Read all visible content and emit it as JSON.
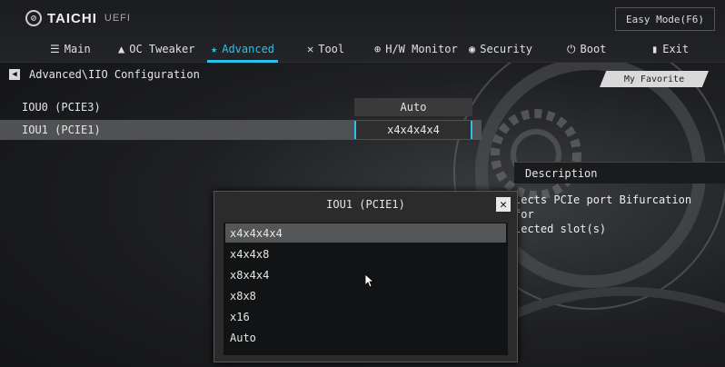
{
  "brand": {
    "name": "TAICHI",
    "sub": "UEFI"
  },
  "easy_mode_label": "Easy Mode(F6)",
  "tabs": [
    {
      "label": "Main",
      "icon": "list-icon"
    },
    {
      "label": "OC Tweaker",
      "icon": "rocket-icon"
    },
    {
      "label": "Advanced",
      "icon": "star-icon"
    },
    {
      "label": "Tool",
      "icon": "tools-icon"
    },
    {
      "label": "H/W Monitor",
      "icon": "monitor-icon"
    },
    {
      "label": "Security",
      "icon": "shield-icon"
    },
    {
      "label": "Boot",
      "icon": "power-icon"
    },
    {
      "label": "Exit",
      "icon": "exit-icon"
    }
  ],
  "active_tab": "Advanced",
  "breadcrumb": "Advanced\\IIO Configuration",
  "favorite_label": "My Favorite",
  "settings": [
    {
      "label": "IOU0 (PCIE3)",
      "value": "Auto"
    },
    {
      "label": "IOU1 (PCIE1)",
      "value": "x4x4x4x4"
    }
  ],
  "description": {
    "title": "Description",
    "lines": [
      "lects PCIe port Bifurcation for",
      "lected slot(s)"
    ]
  },
  "popup": {
    "title": "IOU1 (PCIE1)",
    "options": [
      "x4x4x4x4",
      "x4x4x8",
      "x8x4x4",
      "x8x8",
      "x16",
      "Auto"
    ],
    "selected": "x4x4x4x4"
  },
  "accent_color": "#29c3e9"
}
